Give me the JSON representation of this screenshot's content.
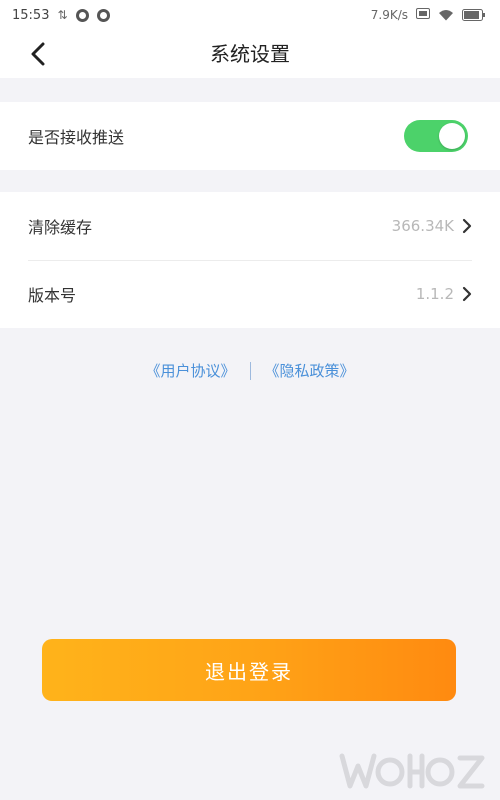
{
  "status_bar": {
    "time": "15:53",
    "network_speed": "7.9K/s"
  },
  "nav": {
    "title": "系统设置"
  },
  "settings": {
    "push": {
      "label": "是否接收推送",
      "enabled": true
    },
    "cache": {
      "label": "清除缓存",
      "value": "366.34K"
    },
    "version": {
      "label": "版本号",
      "value": "1.1.2"
    }
  },
  "links": {
    "user_agreement": "《用户协议》",
    "privacy_policy": "《隐私政策》"
  },
  "logout": {
    "label": "退出登录"
  },
  "colors": {
    "accent_orange": "#ffa417",
    "toggle_on": "#4cd26a",
    "link_blue": "#4a90d9",
    "background": "#f3f3f7"
  },
  "icons": {
    "back": "chevron-left-icon",
    "row_arrow": "chevron-right-icon",
    "wifi": "wifi-icon",
    "battery": "battery-icon"
  }
}
